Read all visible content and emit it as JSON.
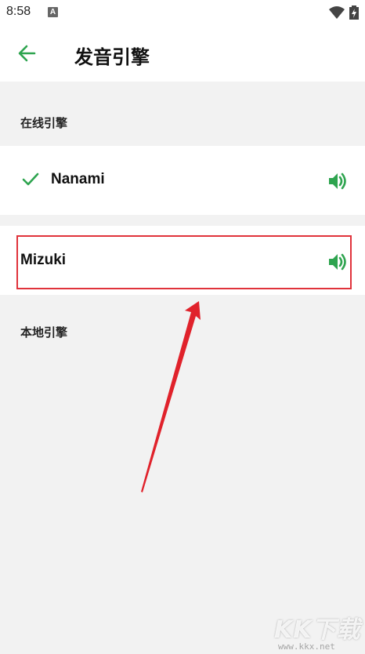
{
  "status_bar": {
    "time": "8:58",
    "notification_letter": "A"
  },
  "header": {
    "title": "发音引擎"
  },
  "online_section": {
    "label": "在线引擎"
  },
  "engines": [
    {
      "name": "Nanami",
      "selected": true
    },
    {
      "name": "Mizuki",
      "selected": false
    }
  ],
  "local_section": {
    "label": "本地引擎"
  },
  "colors": {
    "accent": "#2ea44f",
    "highlight": "#e0333b",
    "background": "#f2f2f2"
  },
  "watermark": {
    "logo": "KK下载",
    "url": "www.kkx.net"
  }
}
